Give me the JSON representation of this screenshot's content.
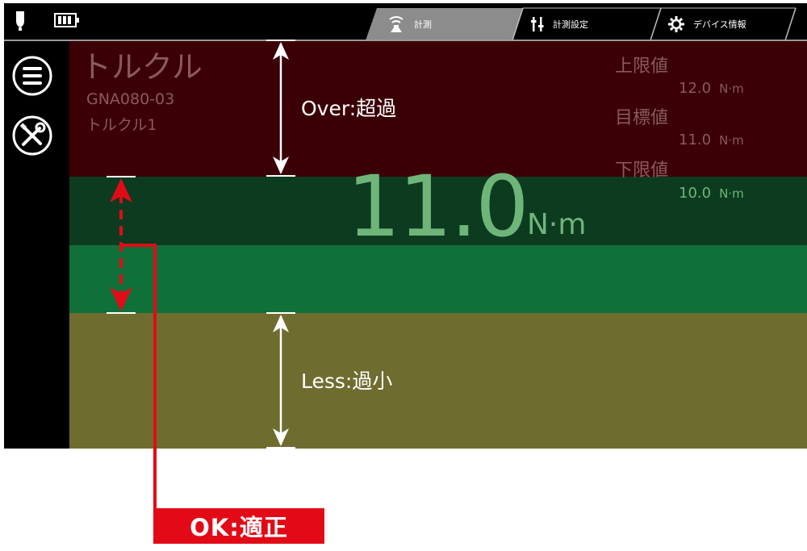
{
  "colors": {
    "over_band": "#3b0006",
    "ok_band_dark": "#0d3b20",
    "ok_band": "#107039",
    "less_band": "#6f6c30",
    "value_text": "#6fb57a",
    "annotation_red": "#e30a17"
  },
  "statusbar": {
    "probe_icon": "torque-wrench-icon",
    "battery_icon": "battery-icon"
  },
  "tabs": [
    {
      "label": "計測",
      "icon": "signal-icon",
      "active": true
    },
    {
      "label": "計測設定",
      "icon": "settings-icon",
      "active": false
    },
    {
      "label": "デバイス情報",
      "icon": "gear-icon",
      "active": false
    }
  ],
  "sidebar": {
    "menu_icon": "menu-icon",
    "tools_icon": "tools-icon"
  },
  "tool": {
    "title": "トルクル",
    "model": "GNA080-03",
    "name": "トルクル1"
  },
  "limits": {
    "upper_label": "上限値",
    "upper_value": "12.0",
    "target_label": "目標値",
    "target_value": "11.0",
    "lower_label": "下限値",
    "lower_value": "10.0",
    "unit": "N·m"
  },
  "measurement": {
    "value": "11.0",
    "unit": "N·m"
  },
  "annotations": {
    "over": "Over:超過",
    "less": "Less:過小",
    "ok": "OK:適正"
  }
}
